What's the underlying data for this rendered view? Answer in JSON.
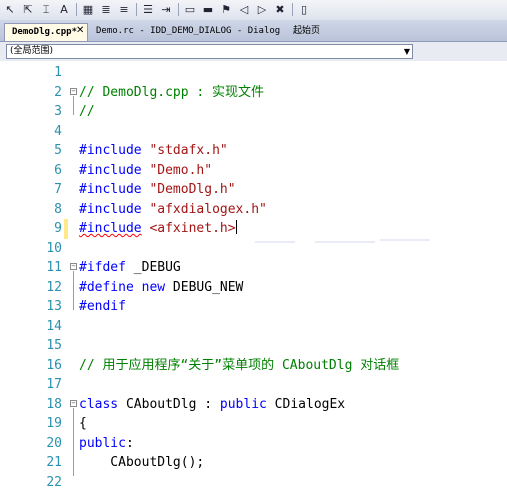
{
  "toolbar": {
    "icons": [
      "pointer-icon",
      "arrow-icon",
      "cursor-icon",
      "font-icon",
      "separator",
      "grid-icon",
      "align-left-icon",
      "align-right-icon",
      "separator",
      "list-icon",
      "indent-icon",
      "separator",
      "comment-icon",
      "uncomment-icon",
      "bookmark-icon",
      "bookmark-prev-icon",
      "bookmark-next-icon",
      "bookmark-clear-icon",
      "separator",
      "scroll-icon"
    ]
  },
  "tabs": [
    {
      "label": "DemoDlg.cpp*",
      "active": true
    },
    {
      "label": "Demo.rc - IDD_DEMO_DIALOG - Dialog",
      "active": false
    },
    {
      "label": "起始页",
      "active": false
    }
  ],
  "scope_combo": {
    "value": "(全局范围)"
  },
  "code_lines": [
    {
      "num": "1",
      "tokens": []
    },
    {
      "num": "2",
      "tokens": [
        {
          "t": "// DemoDlg.cpp : 实现文件",
          "c": "comment"
        }
      ]
    },
    {
      "num": "3",
      "tokens": [
        {
          "t": "//",
          "c": "comment"
        }
      ]
    },
    {
      "num": "4",
      "tokens": []
    },
    {
      "num": "5",
      "tokens": [
        {
          "t": "#include ",
          "c": "kw"
        },
        {
          "t": "\"stdafx.h\"",
          "c": "str"
        }
      ]
    },
    {
      "num": "6",
      "tokens": [
        {
          "t": "#include ",
          "c": "kw"
        },
        {
          "t": "\"Demo.h\"",
          "c": "str"
        }
      ]
    },
    {
      "num": "7",
      "tokens": [
        {
          "t": "#include ",
          "c": "kw"
        },
        {
          "t": "\"DemoDlg.h\"",
          "c": "str"
        }
      ]
    },
    {
      "num": "8",
      "tokens": [
        {
          "t": "#include ",
          "c": "kw"
        },
        {
          "t": "\"afxdialogex.h\"",
          "c": "str"
        }
      ]
    },
    {
      "num": "9",
      "tokens": [
        {
          "t": "#include",
          "c": "kw squiggle"
        },
        {
          "t": " ",
          "c": "plain"
        },
        {
          "t": "<afxinet.h>",
          "c": "str"
        }
      ]
    },
    {
      "num": "10",
      "tokens": []
    },
    {
      "num": "11",
      "tokens": [
        {
          "t": "#ifdef ",
          "c": "kw"
        },
        {
          "t": "_DEBUG",
          "c": "plain"
        }
      ]
    },
    {
      "num": "12",
      "tokens": [
        {
          "t": "#define ",
          "c": "kw"
        },
        {
          "t": "new",
          "c": "kw"
        },
        {
          "t": " DEBUG_NEW",
          "c": "plain"
        }
      ]
    },
    {
      "num": "13",
      "tokens": [
        {
          "t": "#endif",
          "c": "kw"
        }
      ]
    },
    {
      "num": "14",
      "tokens": []
    },
    {
      "num": "15",
      "tokens": []
    },
    {
      "num": "16",
      "tokens": [
        {
          "t": "// 用于应用程序“关于”菜单项的 CAboutDlg 对话框",
          "c": "comment"
        }
      ]
    },
    {
      "num": "17",
      "tokens": []
    },
    {
      "num": "18",
      "tokens": [
        {
          "t": "class",
          "c": "kw"
        },
        {
          "t": " CAboutDlg : ",
          "c": "plain"
        },
        {
          "t": "public",
          "c": "kw"
        },
        {
          "t": " CDialogEx",
          "c": "plain"
        }
      ]
    },
    {
      "num": "19",
      "tokens": [
        {
          "t": "{",
          "c": "plain"
        }
      ]
    },
    {
      "num": "20",
      "tokens": [
        {
          "t": "public",
          "c": "kw"
        },
        {
          "t": ":",
          "c": "plain"
        }
      ]
    },
    {
      "num": "21",
      "tokens": [
        {
          "t": "    CAboutDlg();",
          "c": "plain"
        }
      ]
    },
    {
      "num": "22",
      "tokens": []
    }
  ]
}
